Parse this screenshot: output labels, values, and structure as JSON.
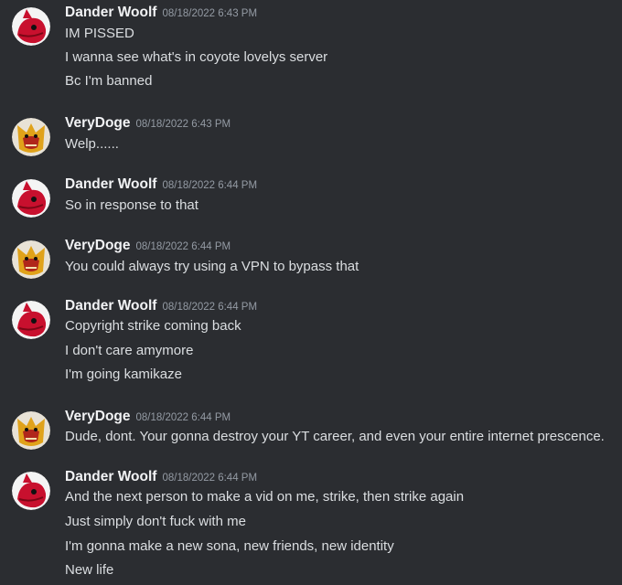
{
  "users": {
    "dander": {
      "name": "Dander Woolf",
      "avatar_icon": "red-wolf-avatar-icon",
      "avatar_color": "#c8102e"
    },
    "verydoge": {
      "name": "VeryDoge",
      "avatar_icon": "golden-dog-avatar-icon",
      "avatar_color": "#e0a21a"
    }
  },
  "messages": [
    {
      "author": "Dander Woolf",
      "time": "08/18/2022 6:43 PM",
      "lines": [
        "IM PISSED",
        "I wanna see what's in coyote lovelys server",
        "Bc I'm banned"
      ]
    },
    {
      "author": "VeryDoge",
      "time": "08/18/2022 6:43 PM",
      "lines": [
        "Welp......"
      ]
    },
    {
      "author": "Dander Woolf",
      "time": "08/18/2022 6:44 PM",
      "lines": [
        "So in response to that"
      ]
    },
    {
      "author": "VeryDoge",
      "time": "08/18/2022 6:44 PM",
      "lines": [
        "You could always try using a VPN to bypass that"
      ]
    },
    {
      "author": "Dander Woolf",
      "time": "08/18/2022 6:44 PM",
      "lines": [
        "Copyright strike coming back",
        "I don't care amymore",
        "I'm going kamikaze"
      ]
    },
    {
      "author": "VeryDoge",
      "time": "08/18/2022 6:44 PM",
      "lines": [
        "Dude, dont. Your gonna destroy your YT career, and even your entire internet prescence."
      ]
    },
    {
      "author": "Dander Woolf",
      "time": "08/18/2022 6:44 PM",
      "lines": [
        "And the next person to make a vid on me, strike, then strike again",
        "Just simply don't fuck with me",
        "I'm gonna make a new sona, new friends, new identity",
        "New life"
      ]
    }
  ]
}
